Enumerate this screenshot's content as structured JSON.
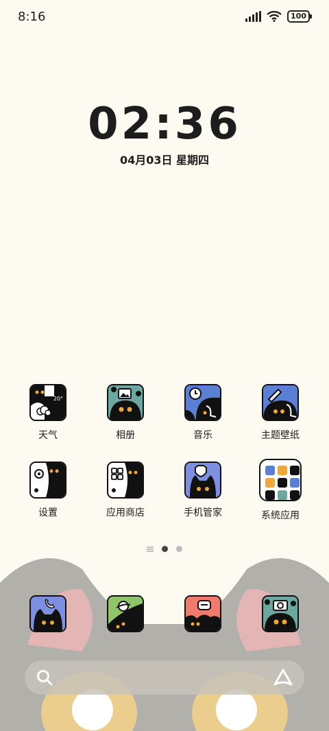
{
  "status": {
    "time": "8:16",
    "battery": "100"
  },
  "clock": {
    "time": "02:36",
    "date": "04月03日 星期四"
  },
  "apps_row1": [
    {
      "label": "天气",
      "icon": "weather-icon",
      "temp": "20°"
    },
    {
      "label": "相册",
      "icon": "gallery-icon"
    },
    {
      "label": "音乐",
      "icon": "music-icon"
    },
    {
      "label": "主题壁纸",
      "icon": "themes-icon"
    }
  ],
  "apps_row2": [
    {
      "label": "设置",
      "icon": "settings-icon"
    },
    {
      "label": "应用商店",
      "icon": "app-store-icon"
    },
    {
      "label": "手机管家",
      "icon": "security-icon"
    },
    {
      "label": "系统应用",
      "icon": "folder-icon"
    }
  ],
  "dock": [
    {
      "icon": "phone-icon"
    },
    {
      "icon": "browser-icon"
    },
    {
      "icon": "messages-icon"
    },
    {
      "icon": "camera-icon"
    }
  ],
  "colors": {
    "background": "#fdfaf1",
    "accent_blue": "#7d8fe0",
    "accent_green": "#8fc46a",
    "accent_red": "#f07a6b",
    "accent_teal": "#6aa8a0"
  }
}
